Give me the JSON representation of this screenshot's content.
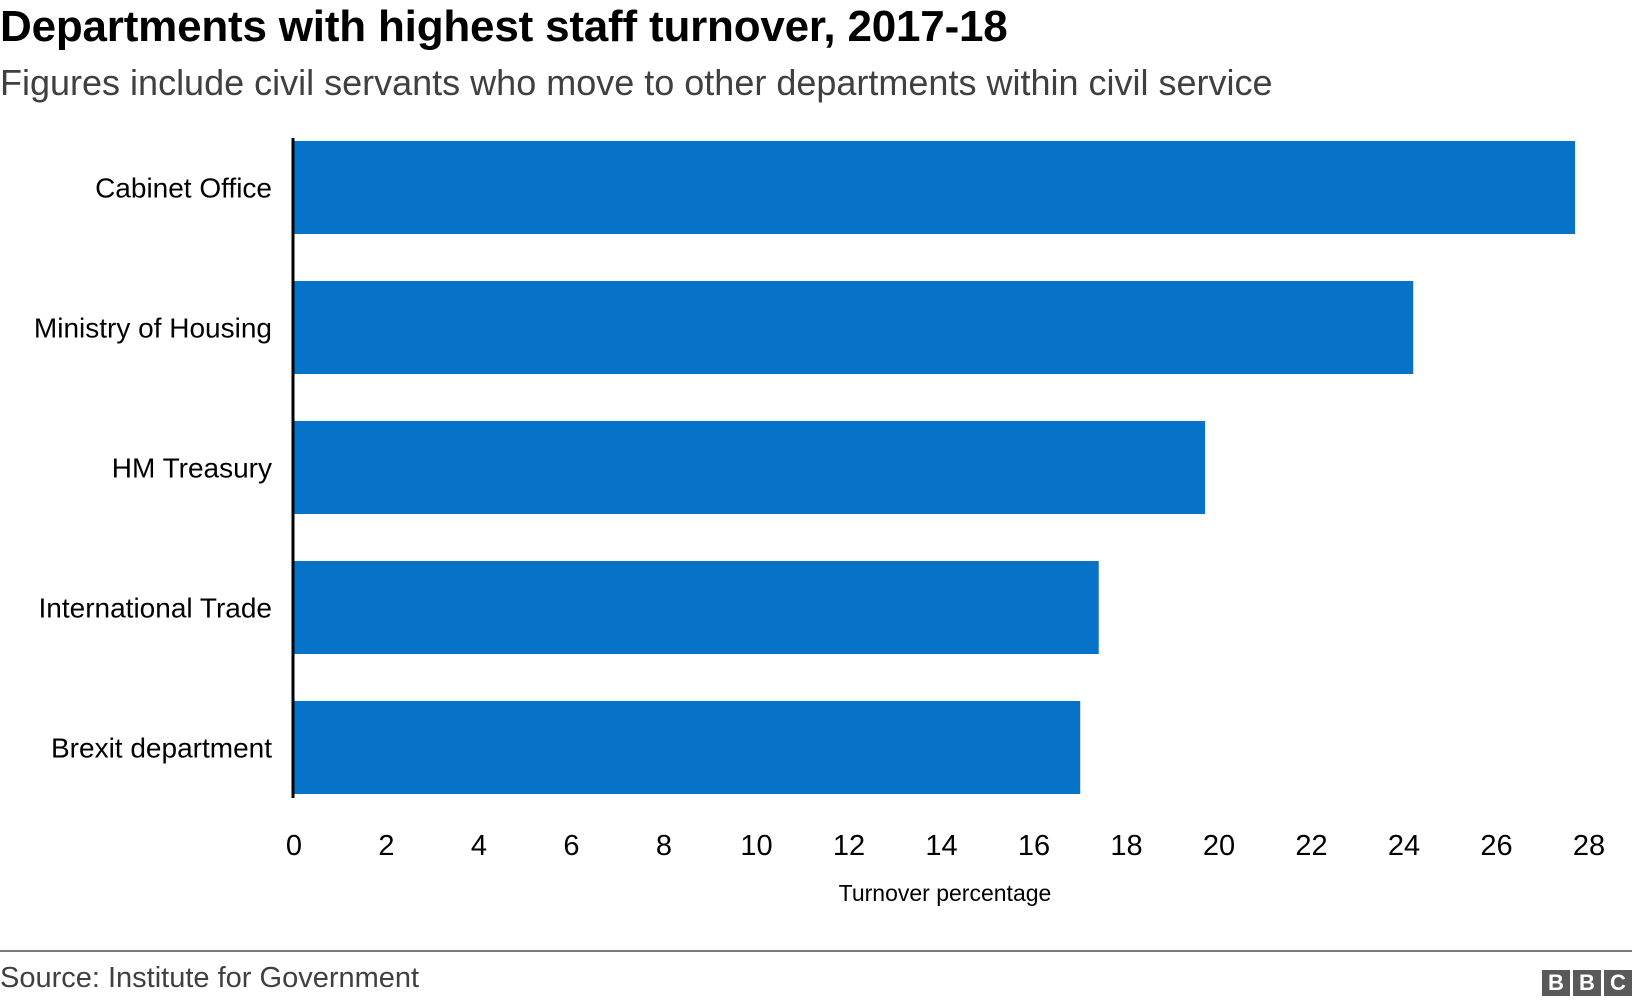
{
  "chart_data": {
    "type": "bar",
    "orientation": "horizontal",
    "title": "Departments with highest staff turnover, 2017-18",
    "subtitle": "Figures include civil servants who move to other departments within civil service",
    "categories": [
      "Cabinet Office",
      "Ministry of Housing",
      "HM Treasury",
      "International Trade",
      "Brexit department"
    ],
    "values": [
      27.7,
      24.2,
      19.7,
      17.4,
      17.0
    ],
    "xlabel": "Turnover percentage",
    "ylabel": "",
    "xlim": [
      0,
      28
    ],
    "xticks": [
      "0",
      "2",
      "4",
      "6",
      "8",
      "10",
      "12",
      "14",
      "16",
      "18",
      "20",
      "22",
      "24",
      "26",
      "28"
    ],
    "grid": false,
    "legend": "none",
    "bar_color": "#0673c8"
  },
  "footer": {
    "source": "Source: Institute for Government",
    "logo_letters": [
      "B",
      "B",
      "C"
    ]
  }
}
